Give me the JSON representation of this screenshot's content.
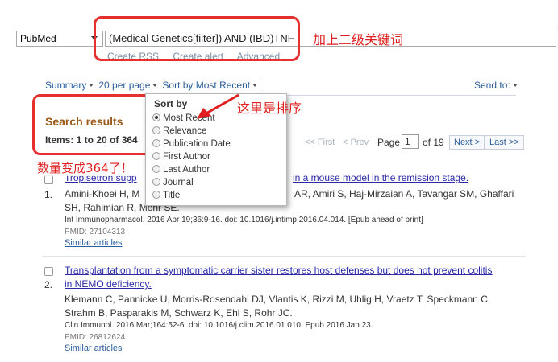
{
  "search": {
    "database": "PubMed",
    "query": "(Medical Genetics[filter]) AND (IBD)TNF",
    "links": [
      "Create RSS",
      "Create alert",
      "Advanced"
    ]
  },
  "annotations": {
    "keyword_note": "加上二级关键词",
    "sort_note": "这里是排序",
    "count_note": "数量变成364了！"
  },
  "toolbar": {
    "summary": "Summary",
    "per_page": "20 per page",
    "sort": "Sort by Most Recent",
    "send_to": "Send to:"
  },
  "results": {
    "title": "Search results",
    "items": "Items: 1 to 20 of 364"
  },
  "pager": {
    "first": "<< First",
    "prev": "< Prev",
    "page_label": "Page",
    "page_value": "1",
    "of": "of 19",
    "next": "Next >",
    "last": "Last >>"
  },
  "sort_menu": {
    "title": "Sort by",
    "options": [
      "Most Recent",
      "Relevance",
      "Publication Date",
      "First Author",
      "Last Author",
      "Journal",
      "Title"
    ],
    "selected": "Most Recent"
  },
  "articles": [
    {
      "num": "1.",
      "title_visible_left": "Tropisetron supp",
      "title_visible_right": "in a mouse model in the remission stage.",
      "authors_line1_left": "Amini-Khoei H, M",
      "authors_line1_right": "AR, Amiri S, Haj-Mirzaian A, Tavangar SM, Ghaffari",
      "authors_line2": "SH, Rahimian R, Mehr SE.",
      "citation": "Int Immunopharmacol. 2016 Apr 19;36:9-16. doi: 10.1016/j.intimp.2016.04.014. [Epub ahead of print]",
      "pmid": "PMID: 27104313",
      "similar": "Similar articles"
    },
    {
      "num": "2.",
      "title_line1": "Transplantation from a symptomatic carrier sister restores host defenses but does not prevent colitis",
      "title_line2": "in NEMO deficiency.",
      "authors_line1": "Klemann C, Pannicke U, Morris-Rosendahl DJ, Vlantis K, Rizzi M, Uhlig H, Vraetz T, Speckmann C,",
      "authors_line2": "Strahm B, Pasparakis M, Schwarz K, Ehl S, Rohr JC.",
      "citation": "Clin Immunol. 2016 Mar;164:52-6. doi: 10.1016/j.clim.2016.01.010. Epub 2016 Jan 23.",
      "pmid": "PMID: 26812624",
      "similar": "Similar articles"
    }
  ],
  "colors": {
    "annotation_red": "#e02020",
    "link_blue": "#2a5d9c",
    "results_brown": "#9c5a1a"
  }
}
